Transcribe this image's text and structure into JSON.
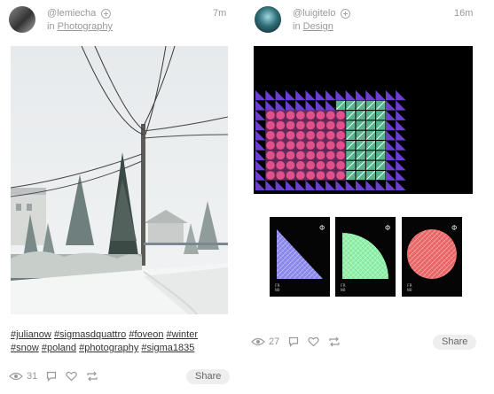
{
  "posts": [
    {
      "username": "@lemiecha",
      "category_prefix": "in",
      "category": "Photography",
      "timestamp": "7m",
      "hashtags": [
        "#julianow",
        "#sigmasdquattro",
        "#foveon",
        "#winter",
        "#snow",
        "#poland",
        "#photography",
        "#sigma1835"
      ],
      "views": "31",
      "share_label": "Share"
    },
    {
      "username": "@luigitelo",
      "category_prefix": "in",
      "category": "Design",
      "timestamp": "16m",
      "views": "27",
      "share_label": "Share",
      "poster_symbol": "Φ",
      "poster_caption_line1": "FR",
      "poster_caption_line2": "NO"
    }
  ],
  "colors": {
    "triangle_purple": "#6a3fd0",
    "grid_pink": "#e0508a",
    "grid_green": "#62c99e",
    "poster_green": "#8ef2a8",
    "poster_coral": "#ee6a6a"
  }
}
